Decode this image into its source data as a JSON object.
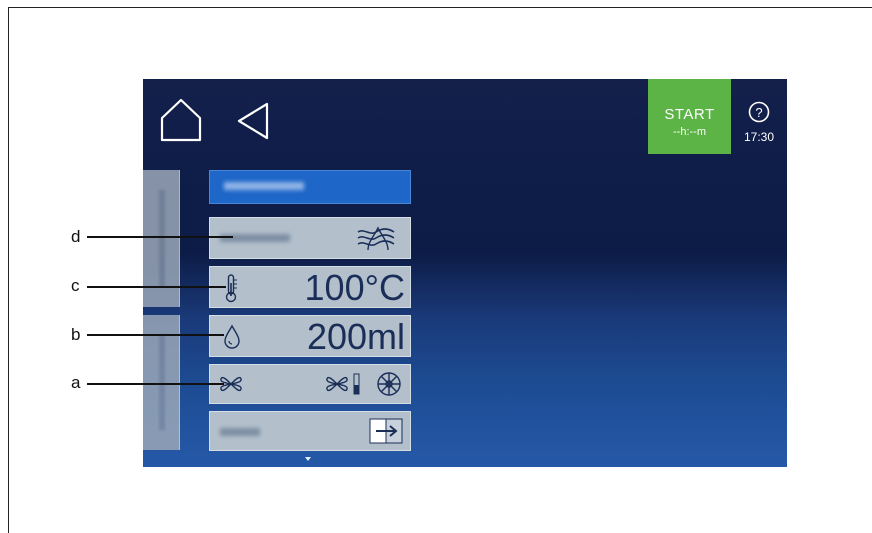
{
  "header": {
    "start_label": "START",
    "start_time": "--h:--m",
    "help_symbol": "?",
    "clock": "17:30"
  },
  "rows": {
    "temperature": "100°C",
    "water": "200ml"
  },
  "callouts": {
    "d": "d",
    "c": "c",
    "b": "b",
    "a": "a"
  },
  "colors": {
    "start_green": "#5cb446",
    "screen_navy": "#0d1c47",
    "row_bg": "#b3c0cc",
    "program_blue": "#1e66c8"
  },
  "icons": {
    "home": "home-icon",
    "back": "back-icon",
    "help": "help-icon",
    "steam": "steam-icon",
    "thermometer": "thermometer-icon",
    "drop": "water-drop-icon",
    "fan": "fan-icon",
    "fan_level": "fan-level-icon",
    "circulation": "circulation-icon",
    "exit": "exit-icon"
  }
}
